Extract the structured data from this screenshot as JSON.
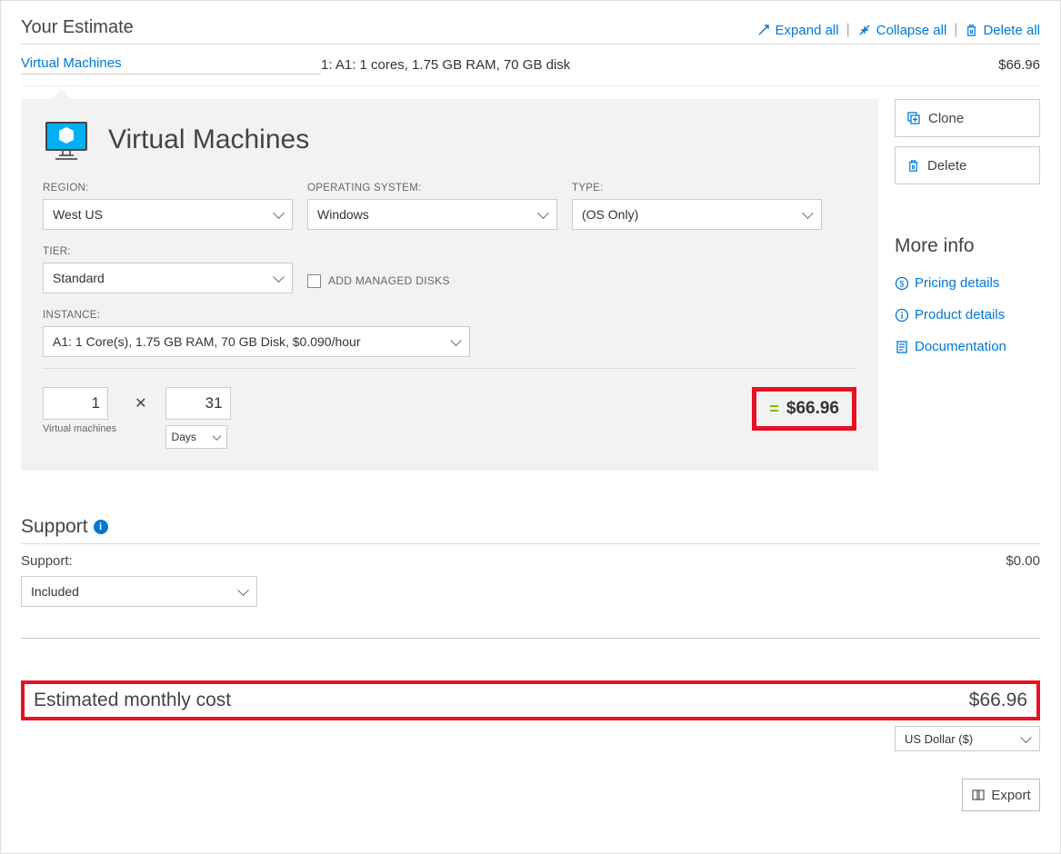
{
  "header": {
    "title": "Your Estimate",
    "expand_all": "Expand all",
    "collapse_all": "Collapse all",
    "delete_all": "Delete all"
  },
  "summary": {
    "name": "Virtual Machines",
    "desc": "1: A1: 1 cores, 1.75 GB RAM, 70 GB disk",
    "price": "$66.96"
  },
  "panel": {
    "title": "Virtual Machines",
    "labels": {
      "region": "REGION:",
      "os": "OPERATING SYSTEM:",
      "type": "TYPE:",
      "tier": "TIER:",
      "instance": "INSTANCE:",
      "managed_disks": "ADD MANAGED DISKS"
    },
    "region": "West US",
    "os": "Windows",
    "type": "(OS Only)",
    "tier": "Standard",
    "instance": "A1: 1 Core(s), 1.75 GB RAM, 70 GB Disk, $0.090/hour",
    "vm_count": "1",
    "vm_label": "Virtual\nmachines",
    "mult": "✕",
    "duration": "31",
    "duration_unit": "Days",
    "eq": "=",
    "result": "$66.96"
  },
  "side": {
    "clone": "Clone",
    "delete": "Delete",
    "more_info": "More info",
    "pricing": "Pricing details",
    "product": "Product details",
    "docs": "Documentation"
  },
  "support": {
    "heading": "Support",
    "label": "Support:",
    "price": "$0.00",
    "value": "Included"
  },
  "monthly": {
    "label": "Estimated monthly cost",
    "price": "$66.96"
  },
  "footer": {
    "currency": "US Dollar ($)",
    "export": "Export"
  }
}
